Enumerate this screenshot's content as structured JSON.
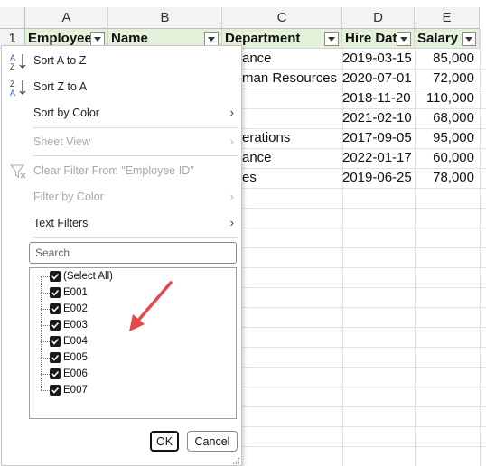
{
  "spreadsheet": {
    "columns": [
      "A",
      "B",
      "C",
      "D",
      "E"
    ],
    "rows": [
      "1"
    ],
    "headers": [
      "Employee I",
      "Name",
      "Department",
      "Hire Date",
      "Salary"
    ],
    "data": [
      [
        "ance",
        "2019-03-15",
        "85,000"
      ],
      [
        "man Resources",
        "2020-07-01",
        "72,000"
      ],
      [
        "",
        "2018-11-20",
        "110,000"
      ],
      [
        "",
        "2021-02-10",
        "68,000"
      ],
      [
        "erations",
        "2017-09-05",
        "95,000"
      ],
      [
        "ance",
        "2022-01-17",
        "60,000"
      ],
      [
        "es",
        "2019-06-25",
        "78,000"
      ]
    ],
    "header_fill": "#e3f0da"
  },
  "filter_menu": {
    "sort_az": "Sort A to Z",
    "sort_za": "Sort Z to A",
    "sort_by_color": "Sort by Color",
    "sheet_view": "Sheet View",
    "clear_filter": "Clear Filter From \"Employee ID\"",
    "filter_by_color": "Filter by Color",
    "text_filters": "Text Filters",
    "search_placeholder": "Search",
    "items": [
      "(Select All)",
      "E001",
      "E002",
      "E003",
      "E004",
      "E005",
      "E006",
      "E007"
    ],
    "ok": "OK",
    "cancel": "Cancel"
  },
  "annotation": {
    "arrow_color": "#e8474a"
  }
}
